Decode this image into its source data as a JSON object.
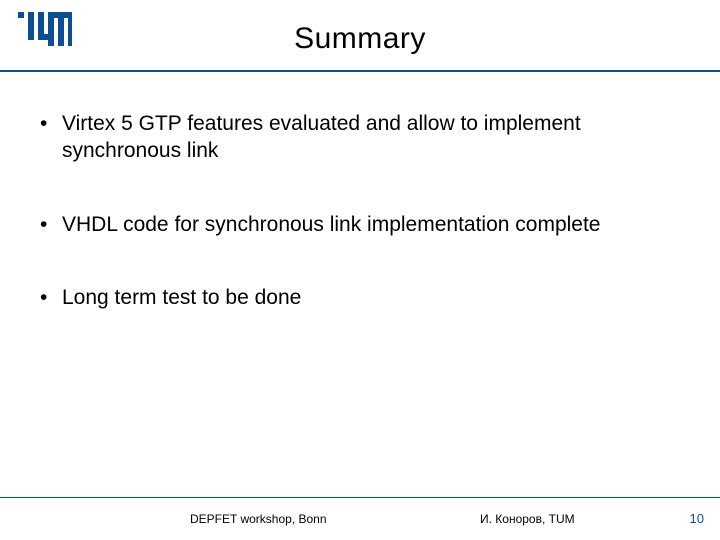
{
  "header": {
    "title": "Summary",
    "logo_name": "tum-logo",
    "brand_color": "#0a4f93"
  },
  "bullets": [
    "Virtex 5 GTP features evaluated and allow to implement synchronous link",
    "VHDL code for synchronous link implementation complete",
    "Long term test to be done"
  ],
  "footer": {
    "left": "DEPFET workshop, Bonn",
    "center": "И. Коноров, TUM",
    "page_number": "10"
  }
}
